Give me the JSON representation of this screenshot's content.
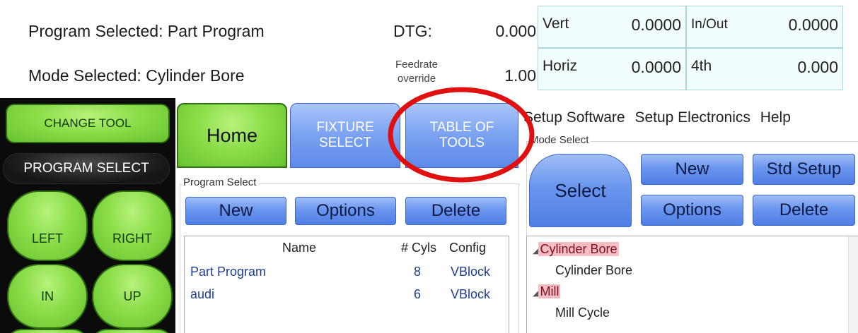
{
  "status": {
    "program_selected": "Program Selected: Part Program",
    "mode_selected": "Mode Selected: Cylinder Bore",
    "dtg_label": "DTG:",
    "dtg_value": "0.000",
    "feedrate_label_1": "Feedrate",
    "feedrate_label_2": "override",
    "feedrate_value": "1.00"
  },
  "dro": {
    "vert_label": "Vert",
    "vert_value": "0.0000",
    "inout_label": "In/Out",
    "inout_value": "0.0000",
    "horiz_label": "Horiz",
    "horiz_value": "0.0000",
    "fourth_label": "4th",
    "fourth_value": "0.000"
  },
  "pendant": {
    "change_tool": "CHANGE TOOL",
    "program_select": "PROGRAM SELECT",
    "left": "LEFT",
    "right": "RIGHT",
    "in": "IN",
    "up": "UP"
  },
  "tabs": {
    "home": "Home",
    "fixture_1": "FIXTURE",
    "fixture_2": "SELECT",
    "tools_1": "TABLE OF",
    "tools_2": "TOOLS"
  },
  "menu": {
    "setup_software": "Setup Software",
    "setup_electronics": "Setup Electronics",
    "help": "Help"
  },
  "program_select": {
    "group_label": "Program Select",
    "new": "New",
    "options": "Options",
    "delete": "Delete",
    "columns": [
      "Name",
      "# Cyls",
      "Config"
    ],
    "rows": [
      {
        "name": "Part Program",
        "cyls": "8",
        "config": "VBlock"
      },
      {
        "name": "audi",
        "cyls": "6",
        "config": "VBlock"
      }
    ]
  },
  "mode_select": {
    "group_label": "Mode Select",
    "select": "Select",
    "new": "New",
    "std_setup": "Std Setup",
    "options": "Options",
    "delete": "Delete",
    "tree": {
      "cat1": "Cylinder Bore",
      "item1": "Cylinder Bore",
      "cat2": "Mill",
      "item2": "Mill Cycle"
    }
  },
  "colors": {
    "green_button": "#8cdd4a",
    "blue_button": "#6b96ee",
    "highlight": "#f6bcc4",
    "annotation_circle": "#e01010"
  }
}
